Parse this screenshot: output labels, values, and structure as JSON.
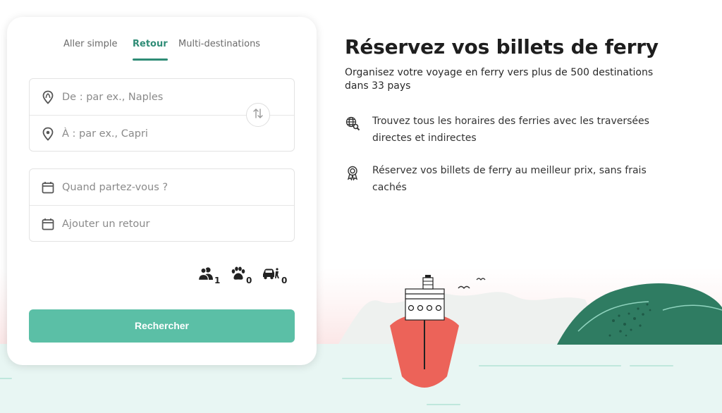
{
  "search": {
    "tabs": [
      {
        "label": "Aller simple",
        "active": false
      },
      {
        "label": "Retour",
        "active": true
      },
      {
        "label": "Multi-destinations",
        "active": false
      }
    ],
    "from_placeholder": "De : par ex., Naples",
    "to_placeholder": "À : par ex., Capri",
    "depart_placeholder": "Quand partez-vous ?",
    "return_placeholder": "Ajouter un retour",
    "passengers": "1",
    "pets": "0",
    "vehicles": "0",
    "submit_label": "Rechercher"
  },
  "hero": {
    "title": "Réservez vos billets de ferry",
    "subtitle": "Organisez votre voyage en ferry vers plus de 500 destinations dans 33 pays",
    "features": [
      {
        "icon": "globe-search-icon",
        "text": "Trouvez tous les horaires des ferries avec les traversées directes et indirectes"
      },
      {
        "icon": "award-badge-icon",
        "text": "Réservez vos billets de ferry au meilleur prix, sans frais cachés"
      }
    ]
  },
  "colors": {
    "accent": "#2f8c76",
    "button": "#5bbfa6",
    "ship_hull": "#ec6359",
    "island": "#2f7c62",
    "sea": "#e8f6f3"
  }
}
